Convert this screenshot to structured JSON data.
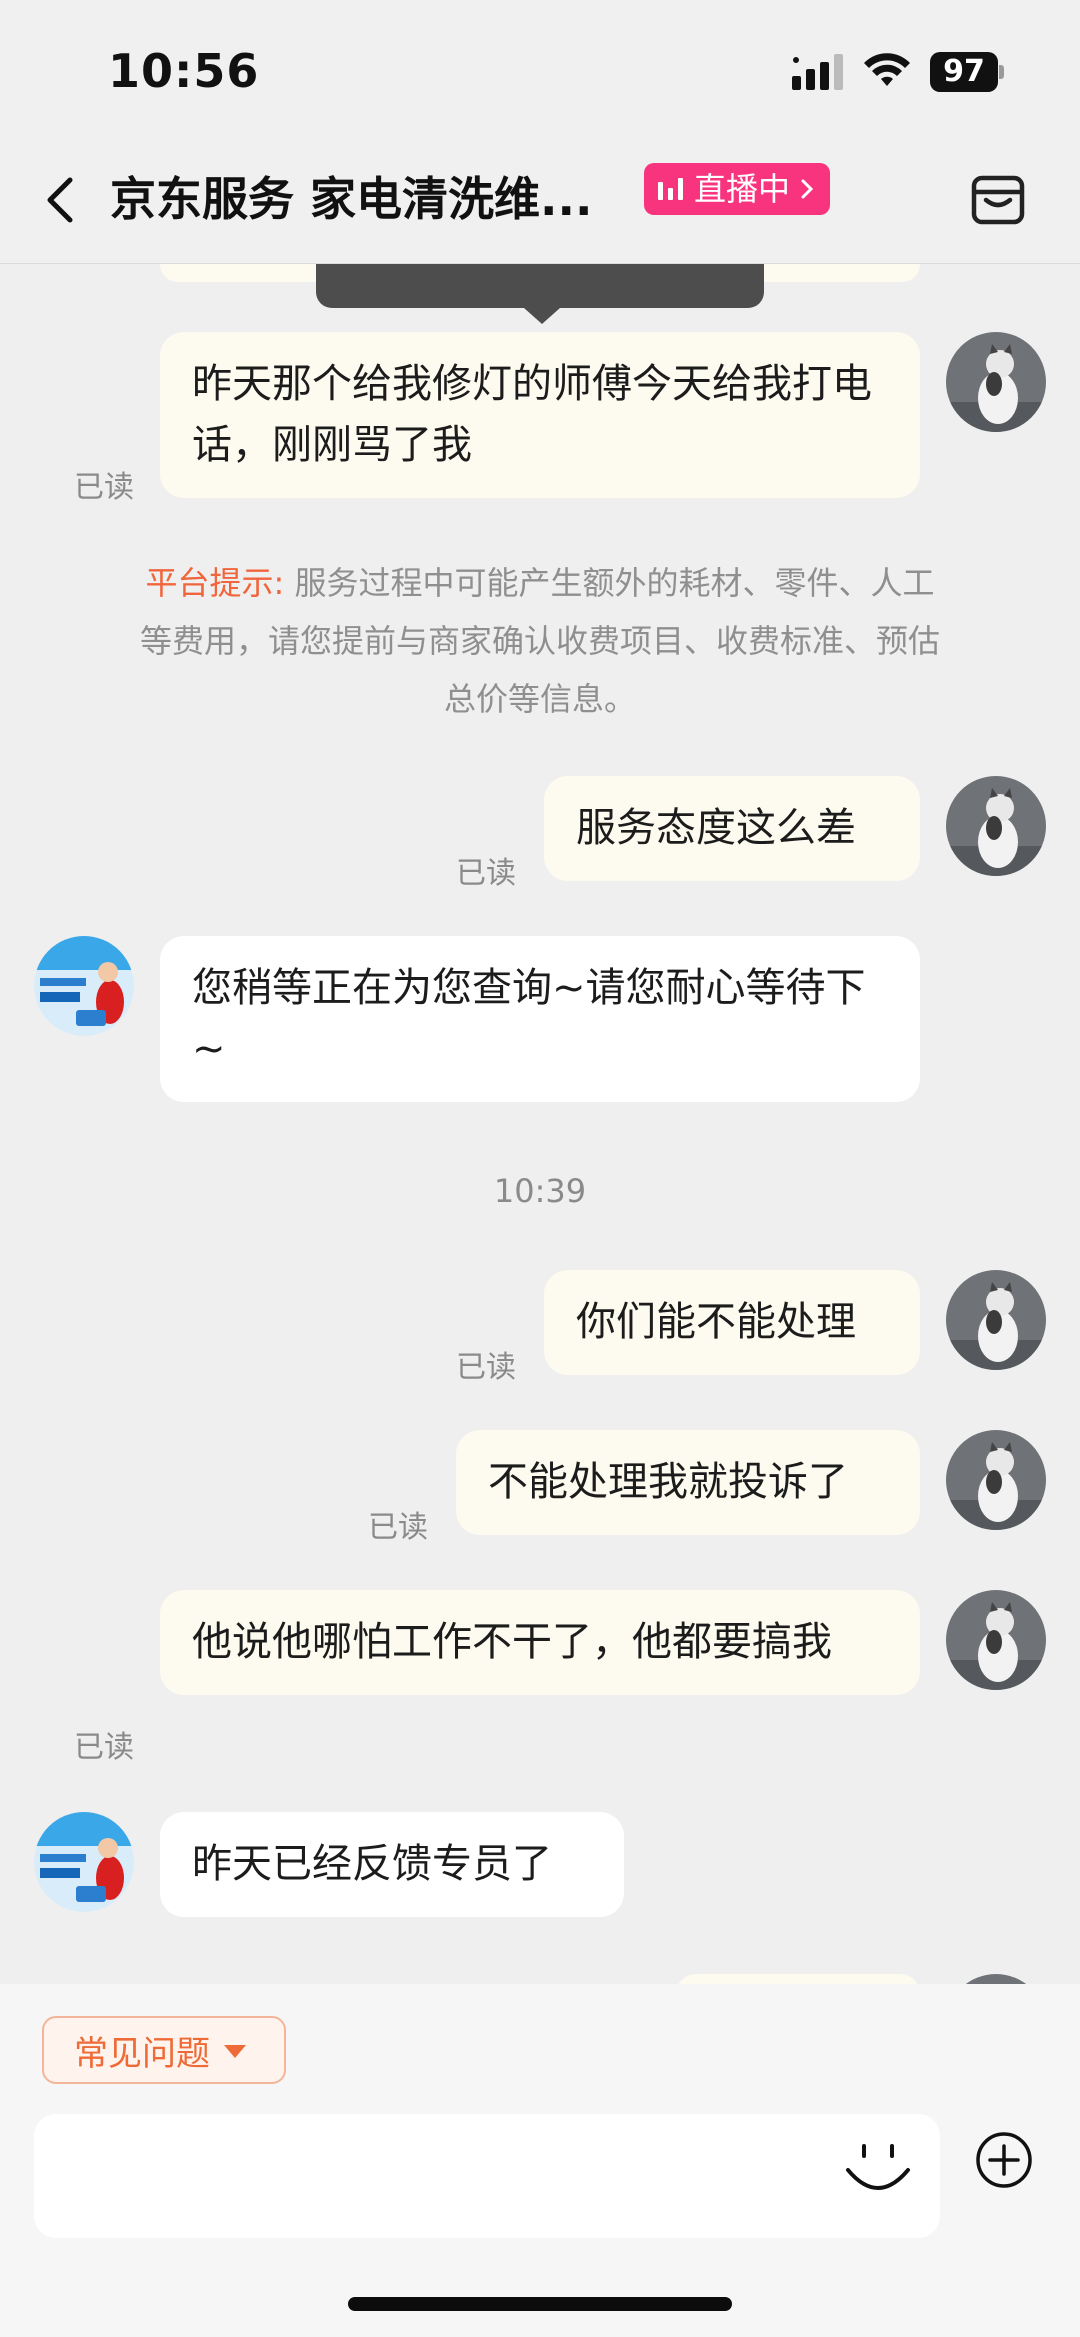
{
  "status_bar": {
    "time": "10:56",
    "battery": "97"
  },
  "header": {
    "back_icon": "chevron-left-icon",
    "title": "京东服务 家电清洗维...",
    "live_label": "直播中",
    "shop_icon": "store-icon"
  },
  "messages": [
    {
      "from": "me",
      "text": "昨天那个给我修灯的师傅今天给我打电话，刚刚骂了我",
      "read": "已读"
    },
    {
      "from": "me",
      "text": "服务态度这么差",
      "read": "已读"
    },
    {
      "from": "them",
      "text": "您稍等正在为您查询~请您耐心等待下 ~"
    },
    {
      "from": "me",
      "text": "你们能不能处理",
      "read": "已读"
    },
    {
      "from": "me",
      "text": "不能处理我就投诉了",
      "read": "已读"
    },
    {
      "from": "me",
      "text": "他说他哪怕工作不干了，他都要搞我",
      "read": "已读"
    },
    {
      "from": "them",
      "text": "昨天已经反馈专员了"
    }
  ],
  "notice": {
    "label": "平台提示:",
    "text": " 服务过程中可能产生额外的耗材、零件、人工等费用，请您提前与商家确认收费项目、收费标准、预估总价等信息。"
  },
  "timestamp": "10:39",
  "bottom": {
    "faq_label": "常见问题",
    "emoji_icon": "smile-icon",
    "plus_icon": "plus-circle-icon"
  },
  "colors": {
    "live_badge": "#f8347f",
    "accent": "#ee6a36",
    "my_bubble": "#fdfbef"
  }
}
